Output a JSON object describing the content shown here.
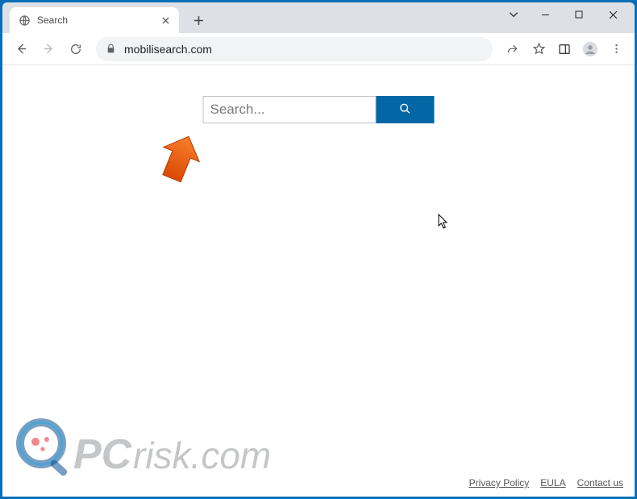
{
  "window": {
    "tab_title": "Search",
    "minimize_tip": "Minimize",
    "maximize_tip": "Maximize",
    "close_tip": "Close"
  },
  "toolbar": {
    "url": "mobilisearch.com"
  },
  "page": {
    "search_placeholder": "Search...",
    "footer": {
      "privacy": "Privacy Policy",
      "eula": "EULA",
      "contact": "Contact us"
    }
  },
  "watermark": {
    "text_pc": "PC",
    "text_rest": "risk.com"
  },
  "colors": {
    "accent": "#0367a6",
    "frame": "#0a6fb5",
    "arrow": "#e85b0c"
  }
}
